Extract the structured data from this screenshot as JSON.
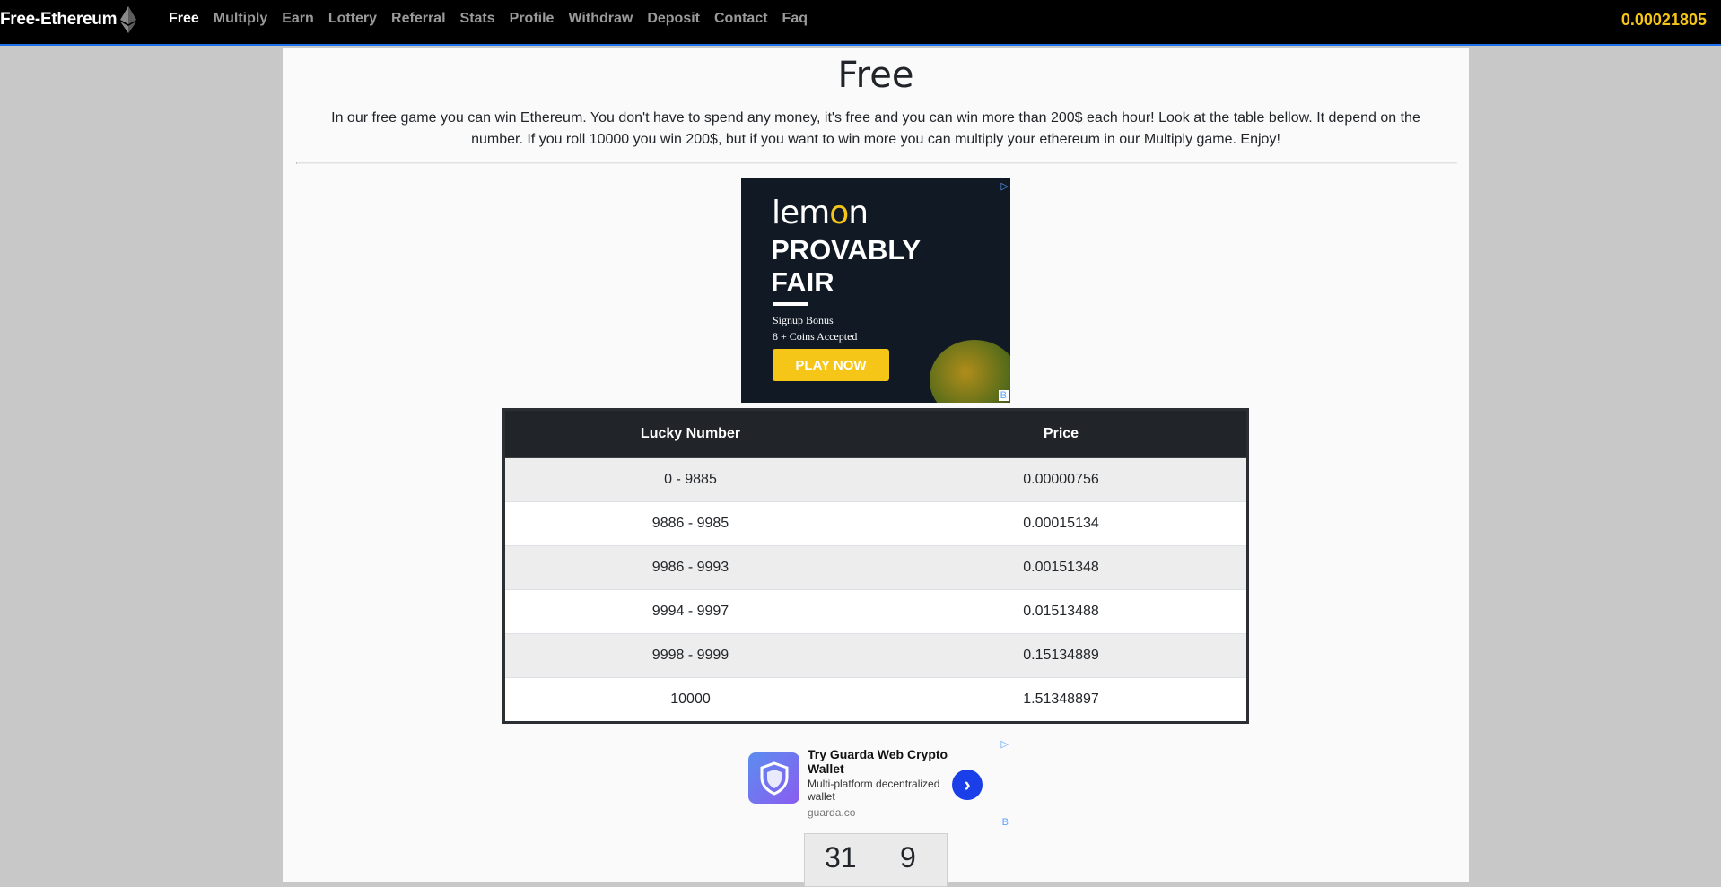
{
  "navbar": {
    "brand": "Free-Ethereum",
    "links": [
      "Free",
      "Multiply",
      "Earn",
      "Lottery",
      "Referral",
      "Stats",
      "Profile",
      "Withdraw",
      "Deposit",
      "Contact",
      "Faq"
    ],
    "active_link": "Free",
    "balance": "0.00021805"
  },
  "page": {
    "title": "Free",
    "intro": "In our free game you can win Ethereum. You don't have to spend any money, it's free and you can win more than 200$ each hour! Look at the table bellow. It depend on the number. If you roll 10000 you win 200$, but if you want to win more you can multiply your ethereum in our Multiply game. Enjoy!"
  },
  "ad_banner": {
    "logo": "lemon",
    "headline_line1": "PROVABLY",
    "headline_line2": "FAIR",
    "sub_line1": "Signup Bonus",
    "sub_line2": "8 + Coins Accepted",
    "cta": "PLAY NOW",
    "adchoice": "▷",
    "badge": "B"
  },
  "prize_table": {
    "headers": [
      "Lucky Number",
      "Price"
    ],
    "rows": [
      [
        "0 - 9885",
        "0.00000756"
      ],
      [
        "9886 - 9985",
        "0.00015134"
      ],
      [
        "9986 - 9993",
        "0.00151348"
      ],
      [
        "9994 - 9997",
        "0.01513488"
      ],
      [
        "9998 - 9999",
        "0.15134889"
      ],
      [
        "10000",
        "1.51348897"
      ]
    ]
  },
  "ad_text": {
    "title": "Try Guarda Web Crypto Wallet",
    "description": "Multi-platform decentralized wallet",
    "url": "guarda.co",
    "adchoice": "▷",
    "badge": "B"
  },
  "countdown": {
    "minutes": "31",
    "seconds": "9"
  },
  "colors": {
    "navbar_bg": "#000000",
    "balance": "#f5c518",
    "table_header": "#212529"
  }
}
